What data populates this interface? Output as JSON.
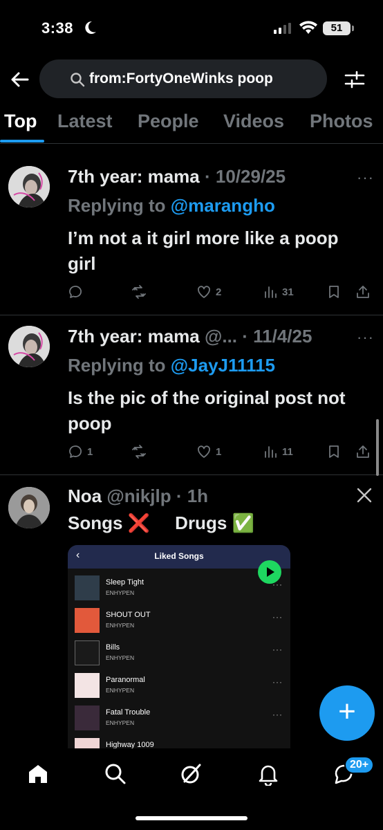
{
  "status_bar": {
    "time": "3:38",
    "battery": "51"
  },
  "search": {
    "query": "from:FortyOneWinks poop"
  },
  "tabs": [
    {
      "label": "Top",
      "active": true
    },
    {
      "label": "Latest",
      "active": false
    },
    {
      "label": "People",
      "active": false
    },
    {
      "label": "Videos",
      "active": false
    },
    {
      "label": "Photos",
      "active": false
    }
  ],
  "posts": [
    {
      "name": "7th year: mama",
      "handle": "",
      "date": "10/29/25",
      "replying_prefix": "Replying to",
      "replying_to": "@marangho",
      "text": "I’m not a it girl more like a poop girl",
      "replies": "",
      "reposts": "",
      "likes": "2",
      "views": "31"
    },
    {
      "name": "7th year: mama",
      "handle": "@...",
      "date": "11/4/25",
      "replying_prefix": "Replying to",
      "replying_to": "@JayJ11115",
      "text": "Is the pic of the original post not poop",
      "replies": "1",
      "reposts": "",
      "likes": "1",
      "views": "11"
    },
    {
      "name": "Noa",
      "handle": "@nikjlp",
      "date": "1h",
      "text": "Songs ❌     Drugs ✅"
    }
  ],
  "embedded": {
    "title": "Liked Songs",
    "songs": [
      {
        "title": "Sleep Tight",
        "artist": "ENHYPEN",
        "cover": "#2f3d4a"
      },
      {
        "title": "SHOUT OUT",
        "artist": "ENHYPEN",
        "cover": "#e2593b"
      },
      {
        "title": "Bills",
        "artist": "ENHYPEN",
        "cover": "#1a1a1a"
      },
      {
        "title": "Paranormal",
        "artist": "ENHYPEN",
        "cover": "#f3e4e4"
      },
      {
        "title": "Fatal Trouble",
        "artist": "ENHYPEN",
        "cover": "#3a2a3a"
      },
      {
        "title": "Highway 1009",
        "artist": "",
        "cover": "#f0d6d6"
      }
    ]
  },
  "fab": {
    "label": "+"
  },
  "bottom_nav": {
    "notifications_badge": "20+"
  },
  "colors": {
    "accent": "#1d9bf0",
    "muted": "#71767b",
    "spotify_green": "#1ed760"
  }
}
